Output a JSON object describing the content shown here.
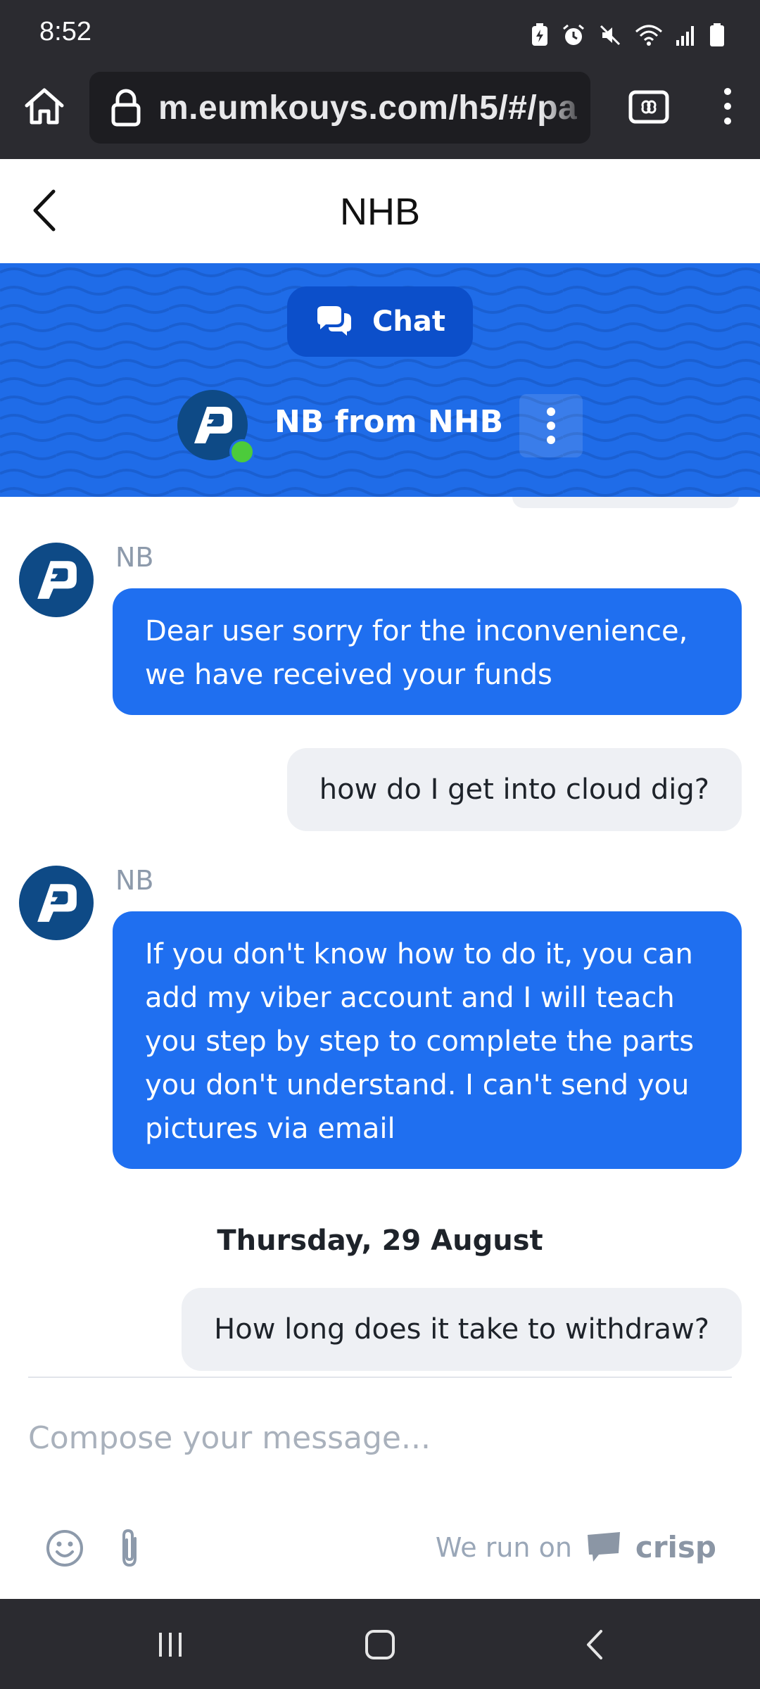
{
  "status_bar": {
    "time": "8:52",
    "icons": [
      "battery-saver-icon",
      "alarm-icon",
      "mute-icon",
      "wifi-icon",
      "signal-icon",
      "battery-icon"
    ]
  },
  "browser": {
    "url": "m.eumkouys.com/h5/#/pa",
    "icons": [
      "home-icon",
      "lock-icon",
      "tab-switcher-icon",
      "more-menu-icon"
    ]
  },
  "page": {
    "title": "NHB"
  },
  "chat_widget": {
    "tab_label": "Chat",
    "agent_name": "NB from NHB",
    "agent_status": "online"
  },
  "messages": [
    {
      "sender": "NB",
      "role": "operator",
      "text": "Dear user sorry for the inconvenience, we have received your funds"
    },
    {
      "role": "user",
      "text": "how do I get into cloud dig?"
    },
    {
      "sender": "NB",
      "role": "operator",
      "text": "If you don't know how to do it, you can add my viber account and I will teach you step by step to complete the parts you don't understand. I can't send you pictures via email"
    },
    {
      "date_separator": "Thursday, 29 August"
    },
    {
      "role": "user",
      "text": "How long does it take to withdraw?"
    }
  ],
  "composer": {
    "placeholder": "Compose your message...",
    "icons": [
      "emoji-icon",
      "attachment-icon"
    ],
    "powered_by_prefix": "We run on",
    "brand": "crisp"
  },
  "colors": {
    "accent": "#1f6ff0",
    "banner": "#1f6ce8",
    "pill": "#0c4fca",
    "avatar": "#0e4a86",
    "online": "#4ccb3b",
    "system_bars": "#2b2b30"
  },
  "navigation_bar": {
    "icons": [
      "recents-icon",
      "home-nav-icon",
      "back-nav-icon"
    ]
  }
}
